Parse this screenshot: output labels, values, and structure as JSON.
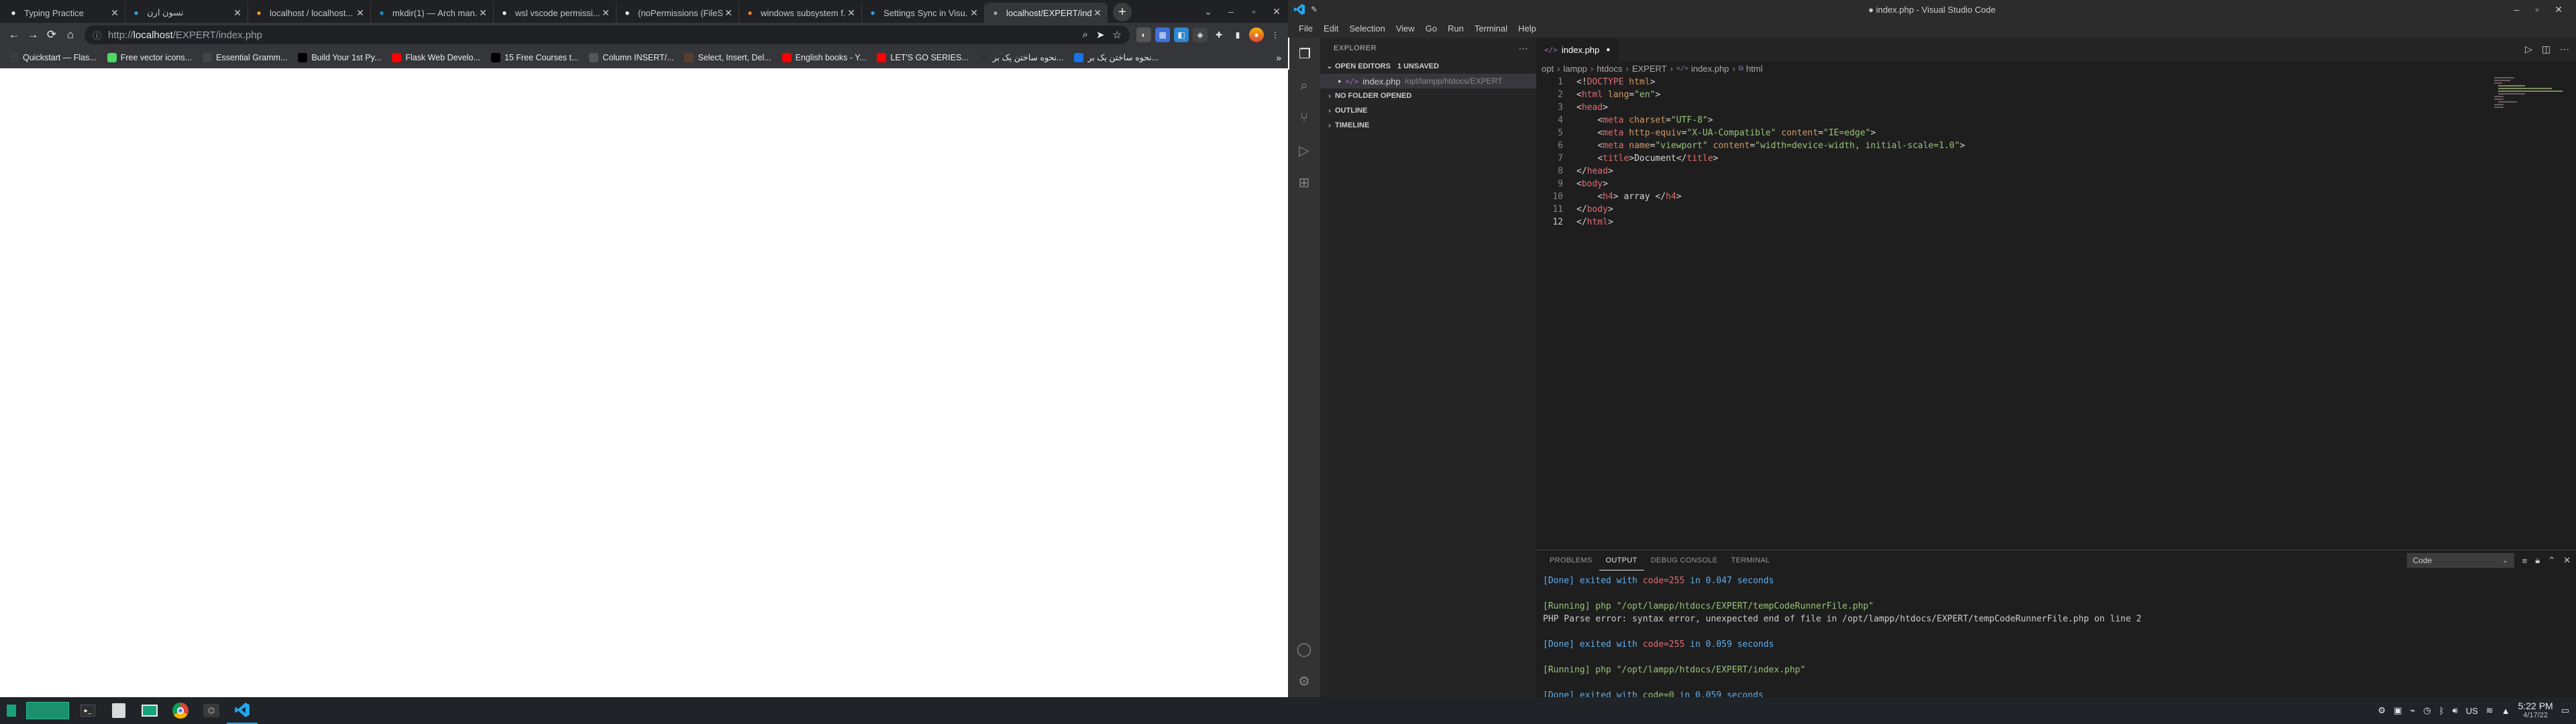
{
  "browser": {
    "tabs": [
      {
        "title": "Typing Practice",
        "icon": "typing-icon",
        "color": "#ffffff"
      },
      {
        "title": "نسون ارن",
        "icon": "vscode-icon",
        "color": "#23a9f2"
      },
      {
        "title": "localhost / localhost...",
        "icon": "phpmyadmin-icon",
        "color": "#f89c0e"
      },
      {
        "title": "mkdir(1) — Arch man...",
        "icon": "arch-icon",
        "color": "#1793d1"
      },
      {
        "title": "wsl vscode permissi...",
        "icon": "google-icon",
        "color": "#ffffff"
      },
      {
        "title": "(noPermissions (FileS...",
        "icon": "github-icon",
        "color": "#ffffff"
      },
      {
        "title": "windows subsystem f...",
        "icon": "stackoverflow-icon",
        "color": "#f48024"
      },
      {
        "title": "Settings Sync in Visu...",
        "icon": "vscode-icon",
        "color": "#23a9f2"
      },
      {
        "title": "localhost/EXPERT/ind...",
        "icon": "page-icon",
        "color": "#9aa0a6"
      }
    ],
    "url": "http://localhost/EXPERT/index.php",
    "url_scheme": "http://",
    "url_host": "localhost",
    "url_path": "/EXPERT/index.php",
    "bookmarks": [
      {
        "label": "Quickstart — Flas...",
        "icon": "flask-icon",
        "color": "#3c3c3c"
      },
      {
        "label": "Free vector icons...",
        "icon": "flaticon-icon",
        "color": "#4cd964"
      },
      {
        "label": "Essential Gramm...",
        "icon": "grammar-icon",
        "color": "#444444"
      },
      {
        "label": "Build Your 1st Py...",
        "icon": "medium-icon",
        "color": "#000000"
      },
      {
        "label": "Flask Web Develo...",
        "icon": "youtube-icon",
        "color": "#ff0000"
      },
      {
        "label": "15 Free Courses t...",
        "icon": "medium-icon",
        "color": "#000000"
      },
      {
        "label": "Column INSERT/...",
        "icon": "db-icon",
        "color": "#555555"
      },
      {
        "label": "Select, Insert, Del...",
        "icon": "dbeaver-icon",
        "color": "#5a3e2b"
      },
      {
        "label": "English books - Y...",
        "icon": "youtube-icon",
        "color": "#ff0000"
      },
      {
        "label": "LET'S GO SERIES...",
        "icon": "youtube-icon",
        "color": "#ff0000"
      },
      {
        "label": "نحوه ساختن یک بر...",
        "icon": "fa-icon",
        "color": "#333333"
      },
      {
        "label": "نحوه ساختن یک بر...",
        "icon": "blue-circle-icon",
        "color": "#1a73e8"
      }
    ]
  },
  "taskbar": {
    "keyboard_layout": "US",
    "time": "5:22 PM",
    "date": "4/17/22"
  },
  "vscode": {
    "window_title": "● index.php - Visual Studio Code",
    "menu": [
      "File",
      "Edit",
      "Selection",
      "View",
      "Go",
      "Run",
      "Terminal",
      "Help"
    ],
    "explorer_title": "EXPLORER",
    "open_editors": "OPEN EDITORS",
    "unsaved": "1 UNSAVED",
    "open_file": "index.php",
    "open_file_path": "/opt/lampp/htdocs/EXPERT",
    "no_folder": "NO FOLDER OPENED",
    "outline": "OUTLINE",
    "timeline": "TIMELINE",
    "tab_label": "index.php",
    "breadcrumbs": [
      "opt",
      "lampp",
      "htdocs",
      "EXPERT",
      "index.php",
      "html"
    ],
    "panel_tabs": [
      "PROBLEMS",
      "OUTPUT",
      "DEBUG CONSOLE",
      "TERMINAL"
    ],
    "output_channel": "Code",
    "output": [
      {
        "type": "done",
        "pre": "[Done] exited with ",
        "code": "code=255",
        "post": " in 0.047 seconds"
      },
      {
        "type": "blank"
      },
      {
        "type": "run",
        "text": "[Running] php \"/opt/lampp/htdocs/EXPERT/tempCodeRunnerFile.php\""
      },
      {
        "type": "plain",
        "text": "PHP Parse error:  syntax error, unexpected end of file in /opt/lampp/htdocs/EXPERT/tempCodeRunnerFile.php on line 2"
      },
      {
        "type": "blank"
      },
      {
        "type": "done",
        "pre": "[Done] exited with ",
        "code": "code=255",
        "post": " in 0.059 seconds"
      },
      {
        "type": "blank"
      },
      {
        "type": "run",
        "text": "[Running] php \"/opt/lampp/htdocs/EXPERT/index.php\""
      },
      {
        "type": "blank"
      },
      {
        "type": "done",
        "pre": "[Done] exited with ",
        "code": "code=0",
        "post": " in 0.059 seconds"
      }
    ],
    "code_lines": [
      [
        [
          "punc",
          "<!"
        ],
        [
          "tag",
          "DOCTYPE"
        ],
        [
          "txt",
          " "
        ],
        [
          "attr",
          "html"
        ],
        [
          "punc",
          ">"
        ]
      ],
      [
        [
          "punc",
          "<"
        ],
        [
          "tag",
          "html"
        ],
        [
          "txt",
          " "
        ],
        [
          "attr",
          "lang"
        ],
        [
          "punc",
          "="
        ],
        [
          "str",
          "\"en\""
        ],
        [
          "punc",
          ">"
        ]
      ],
      [
        [
          "punc",
          "<"
        ],
        [
          "tag",
          "head"
        ],
        [
          "punc",
          ">"
        ]
      ],
      [
        [
          "txt",
          "    "
        ],
        [
          "punc",
          "<"
        ],
        [
          "tag",
          "meta"
        ],
        [
          "txt",
          " "
        ],
        [
          "attr",
          "charset"
        ],
        [
          "punc",
          "="
        ],
        [
          "str",
          "\"UTF-8\""
        ],
        [
          "punc",
          ">"
        ]
      ],
      [
        [
          "txt",
          "    "
        ],
        [
          "punc",
          "<"
        ],
        [
          "tag",
          "meta"
        ],
        [
          "txt",
          " "
        ],
        [
          "attr",
          "http-equiv"
        ],
        [
          "punc",
          "="
        ],
        [
          "str",
          "\"X-UA-Compatible\""
        ],
        [
          "txt",
          " "
        ],
        [
          "attr",
          "content"
        ],
        [
          "punc",
          "="
        ],
        [
          "str",
          "\"IE=edge\""
        ],
        [
          "punc",
          ">"
        ]
      ],
      [
        [
          "txt",
          "    "
        ],
        [
          "punc",
          "<"
        ],
        [
          "tag",
          "meta"
        ],
        [
          "txt",
          " "
        ],
        [
          "attr",
          "name"
        ],
        [
          "punc",
          "="
        ],
        [
          "str",
          "\"viewport\""
        ],
        [
          "txt",
          " "
        ],
        [
          "attr",
          "content"
        ],
        [
          "punc",
          "="
        ],
        [
          "str",
          "\"width=device-width, initial-scale=1.0\""
        ],
        [
          "punc",
          ">"
        ]
      ],
      [
        [
          "txt",
          "    "
        ],
        [
          "punc",
          "<"
        ],
        [
          "tag",
          "title"
        ],
        [
          "punc",
          ">"
        ],
        [
          "txt",
          "Document"
        ],
        [
          "punc",
          "</"
        ],
        [
          "tag",
          "title"
        ],
        [
          "punc",
          ">"
        ]
      ],
      [
        [
          "punc",
          "</"
        ],
        [
          "tag",
          "head"
        ],
        [
          "punc",
          ">"
        ]
      ],
      [
        [
          "punc",
          "<"
        ],
        [
          "tag",
          "body"
        ],
        [
          "punc",
          ">"
        ]
      ],
      [
        [
          "txt",
          "    "
        ],
        [
          "punc",
          "<"
        ],
        [
          "tag",
          "h4"
        ],
        [
          "punc",
          ">"
        ],
        [
          "txt",
          " array "
        ],
        [
          "punc",
          "</"
        ],
        [
          "tag",
          "h4"
        ],
        [
          "punc",
          ">"
        ]
      ],
      [
        [
          "punc",
          "</"
        ],
        [
          "tag",
          "body"
        ],
        [
          "punc",
          ">"
        ]
      ],
      [
        [
          "punc",
          "</"
        ],
        [
          "tag",
          "html"
        ],
        [
          "punc",
          ">"
        ]
      ]
    ],
    "current_line": 12
  }
}
